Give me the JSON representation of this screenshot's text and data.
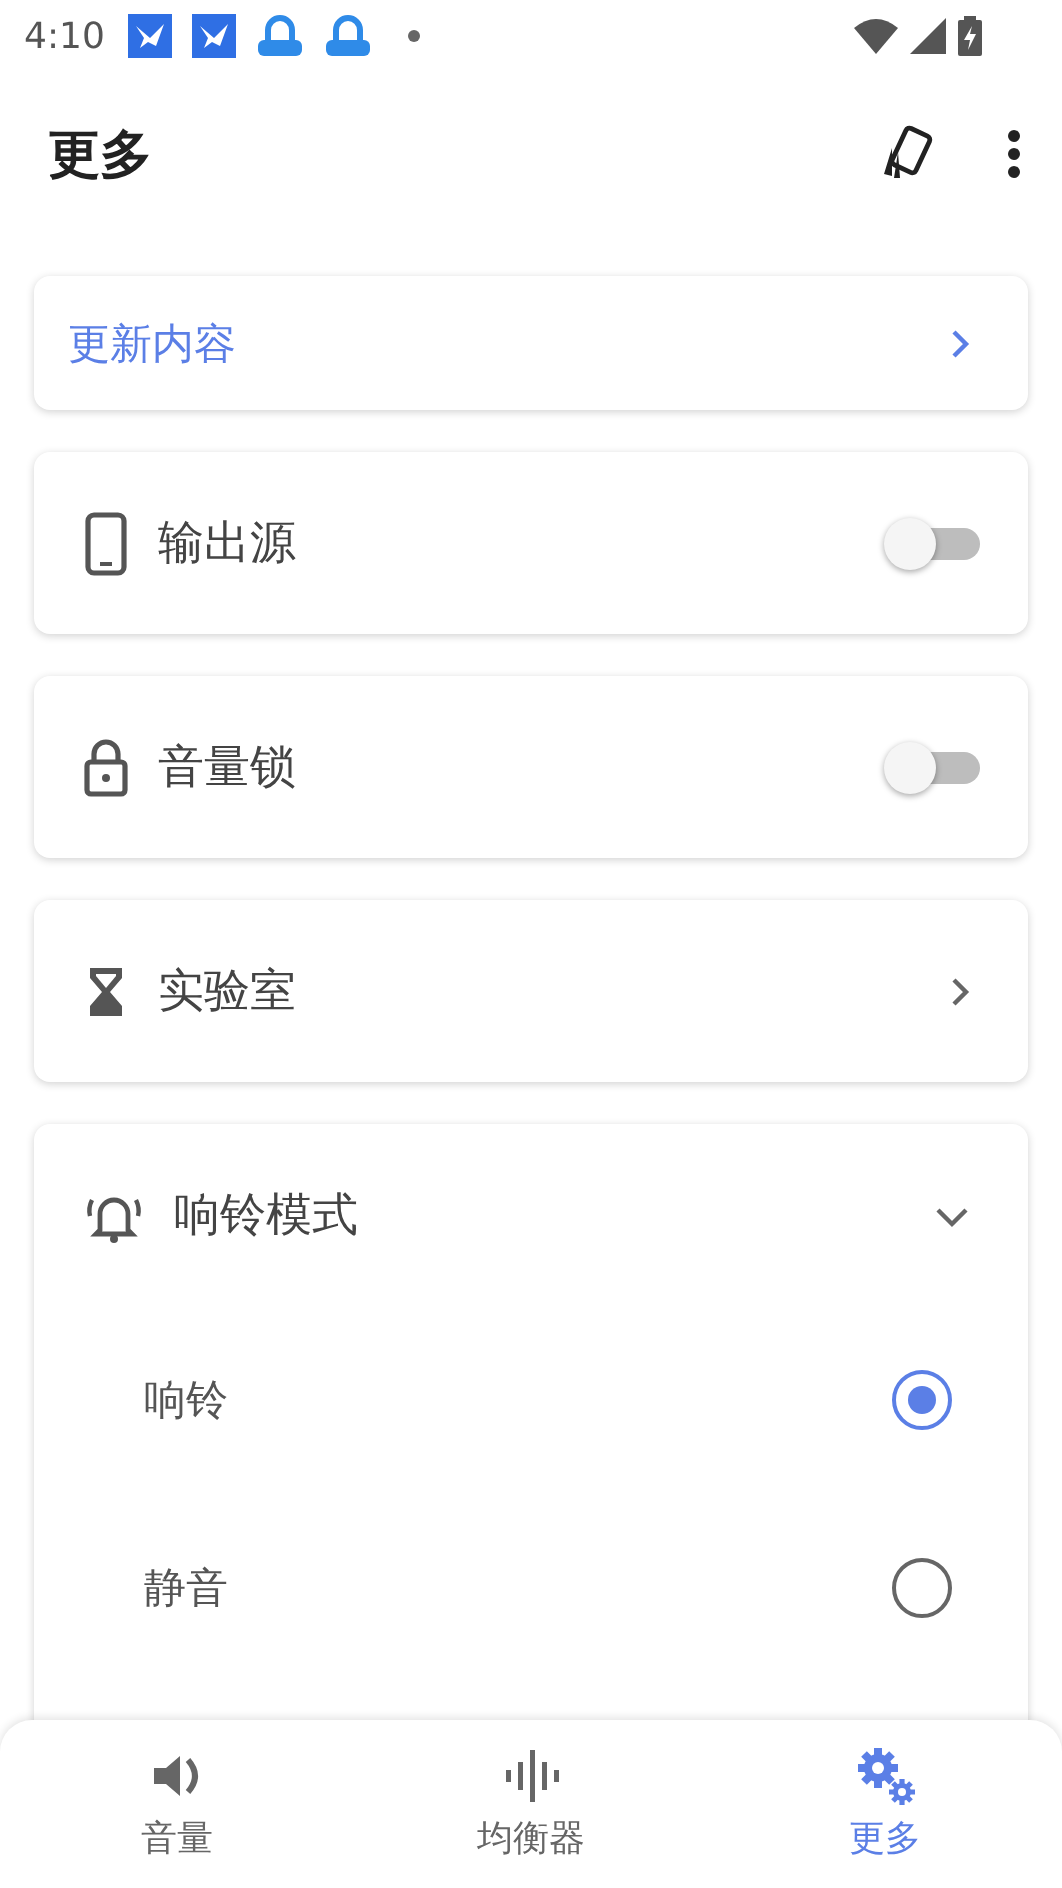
{
  "status_bar": {
    "time": "4:10"
  },
  "app_bar": {
    "title": "更多"
  },
  "cards": [
    {
      "kind": "notice",
      "label": "更新内容"
    },
    {
      "kind": "toggle",
      "label": "输出源",
      "on": false
    },
    {
      "kind": "toggle",
      "label": "音量锁",
      "on": false
    },
    {
      "kind": "link",
      "label": "实验室"
    },
    {
      "kind": "expand",
      "label": "响铃模式",
      "expanded": true,
      "options": [
        {
          "label": "响铃",
          "selected": true
        },
        {
          "label": "静音",
          "selected": false
        }
      ]
    }
  ],
  "bottom_nav": [
    {
      "label": "音量",
      "selected": false
    },
    {
      "label": "均衡器",
      "selected": false
    },
    {
      "label": "更多",
      "selected": true
    }
  ]
}
